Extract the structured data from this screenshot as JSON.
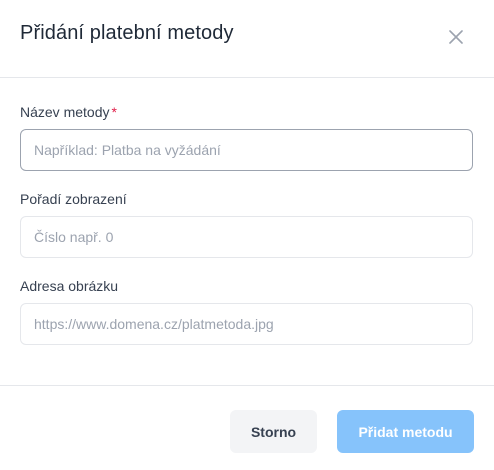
{
  "modal": {
    "title": "Přidání platební metody",
    "close_icon": "close-icon"
  },
  "form": {
    "name": {
      "label": "Název metody",
      "required_mark": "*",
      "placeholder": "Například: Platba na vyžádání",
      "value": ""
    },
    "order": {
      "label": "Pořadí zobrazení",
      "placeholder": "Číslo např. 0",
      "value": ""
    },
    "image": {
      "label": "Adresa obrázku",
      "placeholder": "https://www.domena.cz/platmetoda.jpg",
      "value": ""
    }
  },
  "footer": {
    "cancel_label": "Storno",
    "submit_label": "Přidat metodu"
  },
  "colors": {
    "submit_bg": "#86c3fb",
    "cancel_bg": "#f3f4f6",
    "required": "#e11d48",
    "border": "#e5e7eb"
  }
}
